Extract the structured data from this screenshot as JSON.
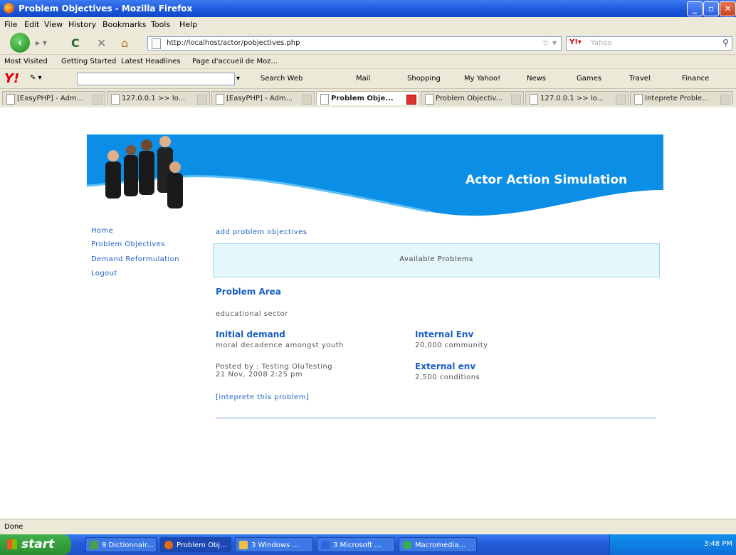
{
  "window": {
    "title": "Problem Objectives - Mozilla Firefox"
  },
  "menu": [
    "File",
    "Edit",
    "View",
    "History",
    "Bookmarks",
    "Tools",
    "Help"
  ],
  "nav": {
    "url": "http://localhost/actor/pobjectives.php",
    "search_engine": "Yahoo"
  },
  "bookmarks": [
    "Most Visited",
    "Getting Started",
    "Latest Headlines",
    "Page d'accueil de Moz..."
  ],
  "yahoo_toolbar": [
    "Search Web",
    "Mail",
    "Shopping",
    "My Yahoo!",
    "News",
    "Games",
    "Travel",
    "Finance"
  ],
  "tabs": [
    {
      "label": "[EasyPHP] - Adm..."
    },
    {
      "label": "127.0.0.1 >> lo..."
    },
    {
      "label": "[EasyPHP] - Adm..."
    },
    {
      "label": "Problem Obje..."
    },
    {
      "label": "Problem Objectiv..."
    },
    {
      "label": "127.0.0.1 >> lo..."
    },
    {
      "label": "Inteprete Proble..."
    }
  ],
  "site": {
    "title": "Actor Action Simulation",
    "nav": [
      "Home",
      "Problem Objectives",
      "Demand Reformulation",
      "Logout"
    ],
    "add_link": "add problem objectives",
    "available": "Available Problems",
    "problem_area_heading": "Problem Area",
    "problem_area": "educational sector",
    "initial_demand_heading": "Initial demand",
    "initial_demand": "moral decadence amongst youth",
    "posted_by": "Posted by : Testing OluTesting",
    "posted_date": "21 Nov, 2008 2:25 pm",
    "internal_env_heading": "Internal Env",
    "internal_env": "20,000 community",
    "external_env_heading": "External env",
    "external_env": "2,500 conditions",
    "interpret_link": "[inteprete this problem]"
  },
  "status": "Done",
  "taskbar": {
    "start": "start",
    "buttons": [
      "9 Dictionnair...",
      "Problem Obj...",
      "3 Windows ...",
      "3 Microsoft ...",
      "Macromedia..."
    ],
    "clock": "3:48 PM"
  }
}
